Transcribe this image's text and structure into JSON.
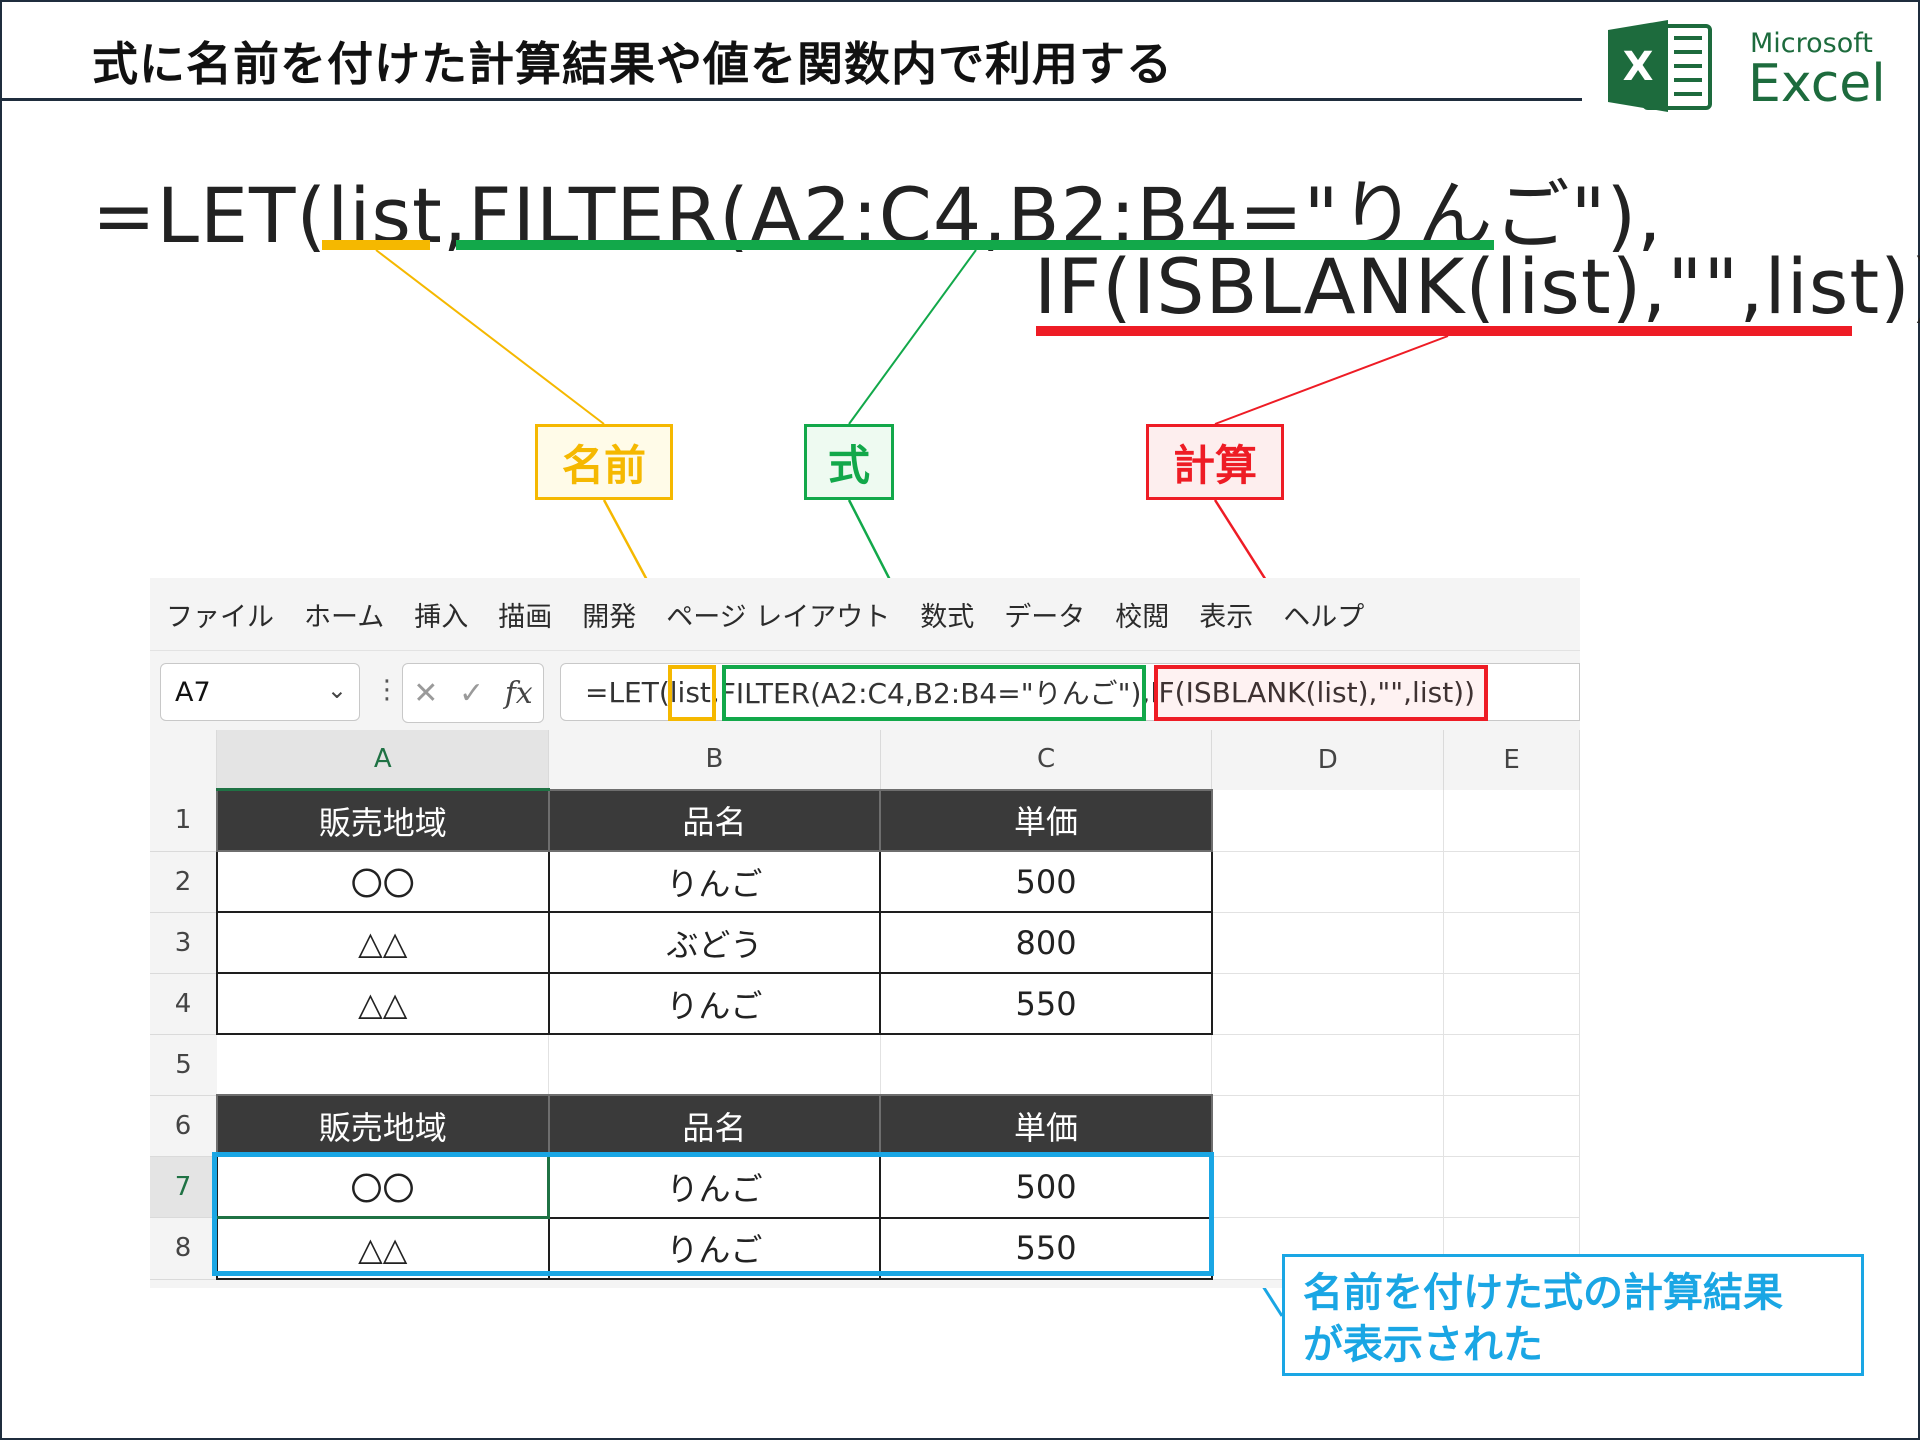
{
  "header": {
    "title": "式に名前を付けた計算結果や値を関数内で利用する",
    "logo_top": "Microsoft",
    "logo_bottom": "Excel",
    "logo_letter": "X"
  },
  "formula": {
    "line1_prefix": "=LET(",
    "line1_name": "list",
    "line1_comma": ",",
    "line1_expr": "FILTER(A2:C4,B2:B4=\"りんご\")",
    "line1_tail": ",",
    "line2_calc": "IF(ISBLANK(list),\"\",list)",
    "line2_tail": ")"
  },
  "callouts": {
    "name_label": "名前",
    "expr_label": "式",
    "calc_label": "計算"
  },
  "colors": {
    "name": "#f5b800",
    "expr": "#12a84a",
    "calc": "#ee1c25",
    "result": "#1aa6e4",
    "excel_green": "#1d6b3d"
  },
  "excel": {
    "ribbon_tabs": [
      "ファイル",
      "ホーム",
      "挿入",
      "描画",
      "開発",
      "ページ レイアウト",
      "数式",
      "データ",
      "校閲",
      "表示",
      "ヘルプ"
    ],
    "name_box": "A7",
    "formula_bar": {
      "prefix": "=LET(",
      "name": "list",
      "comma": ",",
      "expr": "FILTER(A2:C4,B2:B4=\"りんご\")",
      "comma2": ",",
      "calc": "IF(ISBLANK(list),\"\",list)",
      "tail": ")"
    },
    "columns": [
      "A",
      "B",
      "C",
      "D",
      "E"
    ],
    "rows": [
      "1",
      "2",
      "3",
      "4",
      "5",
      "6",
      "7",
      "8"
    ],
    "table1": {
      "headers": [
        "販売地域",
        "品名",
        "単価"
      ],
      "data": [
        [
          "〇〇",
          "りんご",
          "500"
        ],
        [
          "△△",
          "ぶどう",
          "800"
        ],
        [
          "△△",
          "りんご",
          "550"
        ]
      ]
    },
    "table2": {
      "headers": [
        "販売地域",
        "品名",
        "単価"
      ],
      "data": [
        [
          "〇〇",
          "りんご",
          "500"
        ],
        [
          "△△",
          "りんご",
          "550"
        ]
      ]
    }
  },
  "note": {
    "line1": "名前を付けた式の計算結果",
    "line2": "が表示された"
  }
}
